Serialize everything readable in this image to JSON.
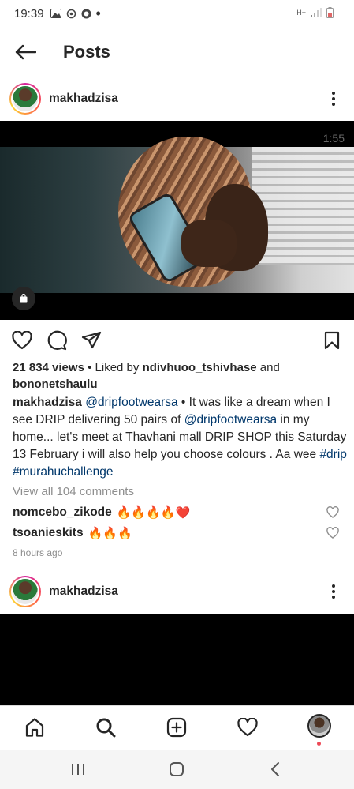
{
  "status_bar": {
    "time": "19:39",
    "network_label": "H+"
  },
  "header": {
    "title": "Posts"
  },
  "post1": {
    "username": "makhadzisa",
    "video_time": "1:55",
    "views": "21 834 views",
    "liked_by_prefix": "• Liked by",
    "liked_by_user": "ndivhuoo_tshivhase",
    "liked_and": "and",
    "liked_by_other": "bononetshaulu",
    "caption": {
      "author": "makhadzisa",
      "mention1": "@dripfootwearsa",
      "text1": " • It was like  a dream when I see  DRIP delivering 50 pairs of ",
      "mention2": "@dripfootwearsa",
      "text2": " in my home... let's  meet at Thavhani mall DRIP SHOP this Saturday 13 February i will  also help you choose colours . Aa wee ",
      "tag1": "#drip",
      "space": " ",
      "tag2": "#murahuchallenge"
    },
    "view_all_comments": "View all 104 comments",
    "comments": [
      {
        "user": "nomcebo_zikode",
        "text": "🔥🔥🔥🔥❤️"
      },
      {
        "user": "tsoanieskits",
        "text": "🔥🔥🔥"
      }
    ],
    "time_ago": "8 hours ago"
  },
  "post2": {
    "username": "makhadzisa"
  },
  "colors": {
    "link": "#00376b",
    "muted": "#8e8e8e",
    "text": "#262626",
    "notification": "#ed4956"
  },
  "icons": {
    "back": "arrow-left-icon",
    "more": "more-vertical-icon",
    "like": "heart-outline-icon",
    "comment": "comment-bubble-icon",
    "share": "paper-plane-icon",
    "save": "bookmark-icon",
    "home": "home-icon",
    "search": "search-icon",
    "add": "add-square-icon",
    "activity": "heart-icon",
    "recents": "recents-icon",
    "android_home": "android-home-icon",
    "android_back": "android-back-icon"
  }
}
